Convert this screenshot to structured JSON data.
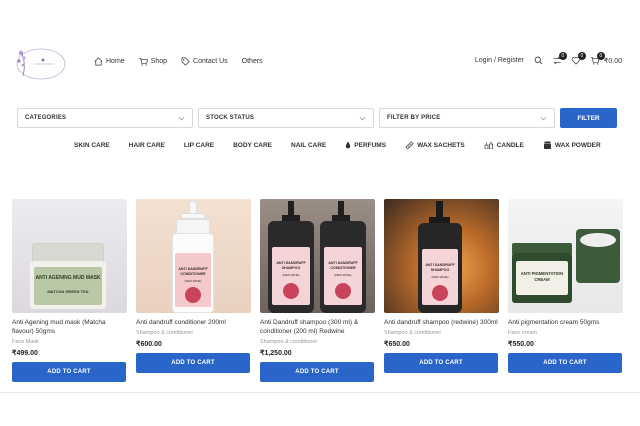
{
  "header": {
    "logo_icon": "flower-logo",
    "nav": [
      {
        "label": "Home",
        "icon": "home-icon"
      },
      {
        "label": "Shop",
        "icon": "cart-icon"
      },
      {
        "label": "Contact Us",
        "icon": "tag-icon"
      },
      {
        "label": "Others",
        "icon": ""
      }
    ],
    "login_label": "Login / Register",
    "compare_count": "0",
    "wishlist_count": "0",
    "cart_count": "0",
    "cart_total": "₹0.00"
  },
  "filters": {
    "categories": "CATEGORIES",
    "stock": "STOCK STATUS",
    "price": "FILTER BY PRICE",
    "button": "FILTER"
  },
  "categories": [
    "SKIN CARE",
    "HAIR CARE",
    "LIP CARE",
    "BODY CARE",
    "NAIL CARE",
    "PERFUMS",
    "WAX SACHETS",
    "CANDLE",
    "WAX POWDER"
  ],
  "products": [
    {
      "name": "Anti Agening mud mask (Matcha flavour) 50gms",
      "category": "Face Mask",
      "price": "₹499.00",
      "button": "ADD TO CART",
      "jar_label": "ANTI AGENING MUD MASK",
      "jar_sub": "MATCHA GREEN TEA"
    },
    {
      "name": "Anti dandruff conditioner 200ml",
      "category": "Shampoo & conditioner",
      "price": "₹600.00",
      "button": "ADD TO CART",
      "bottle_label": "ANTI DANDRUFF CONDITIONER",
      "bottle_sub": "(RED WINE)"
    },
    {
      "name": "Anti Dandruff shampoo (300 ml) & conditioner (200 ml) Redwine",
      "category": "Shampoo & conditioner",
      "price": "₹1,250.00",
      "button": "ADD TO CART",
      "bottle_label": "ANTI DANDRUFF SHAMPOO",
      "bottle_label2": "ANTI DANDRUFF CONDITIONER",
      "bottle_sub": "(RED WINE)"
    },
    {
      "name": "Anti dandruff shampoo (redwine) 300ml",
      "category": "Shampoo & conditioner",
      "price": "₹650.00",
      "button": "ADD TO CART",
      "bottle_label": "ANTI DANDRUFF SHAMPOO",
      "bottle_sub": "(RED WINE)"
    },
    {
      "name": "Anti pigmentation cream 50gms",
      "category": "Face cream",
      "price": "₹550.00",
      "button": "ADD TO CART",
      "jar_label": "ANTI PIGMENTATION CREAM"
    }
  ],
  "colors": {
    "accent": "#2a66c9"
  }
}
